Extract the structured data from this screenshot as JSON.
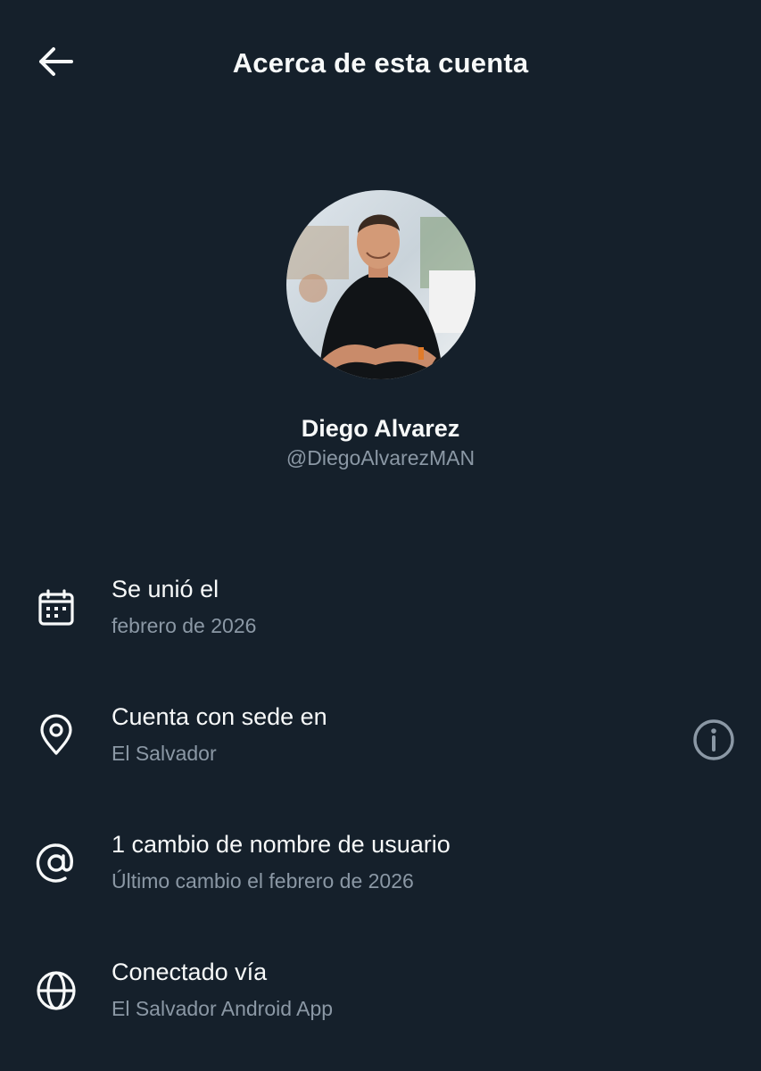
{
  "header": {
    "title": "Acerca de esta cuenta",
    "back_icon": "arrow-left-icon"
  },
  "profile": {
    "display_name": "Diego Alvarez",
    "handle": "@DiegoAlvarezMAN"
  },
  "details": [
    {
      "icon": "calendar-icon",
      "title": "Se unió el",
      "subtitle": "febrero de 2026"
    },
    {
      "icon": "location-pin-icon",
      "title": "Cuenta con sede en",
      "subtitle": "El Salvador",
      "action_icon": "info-icon"
    },
    {
      "icon": "at-sign-icon",
      "title": "1 cambio de nombre de usuario",
      "subtitle": "Último cambio el febrero de 2026"
    },
    {
      "icon": "globe-icon",
      "title": "Conectado vía",
      "subtitle": "El Salvador Android App"
    }
  ],
  "colors": {
    "background": "#15202b",
    "primary_text": "#f7f9f9",
    "secondary_text": "#8b98a5"
  }
}
